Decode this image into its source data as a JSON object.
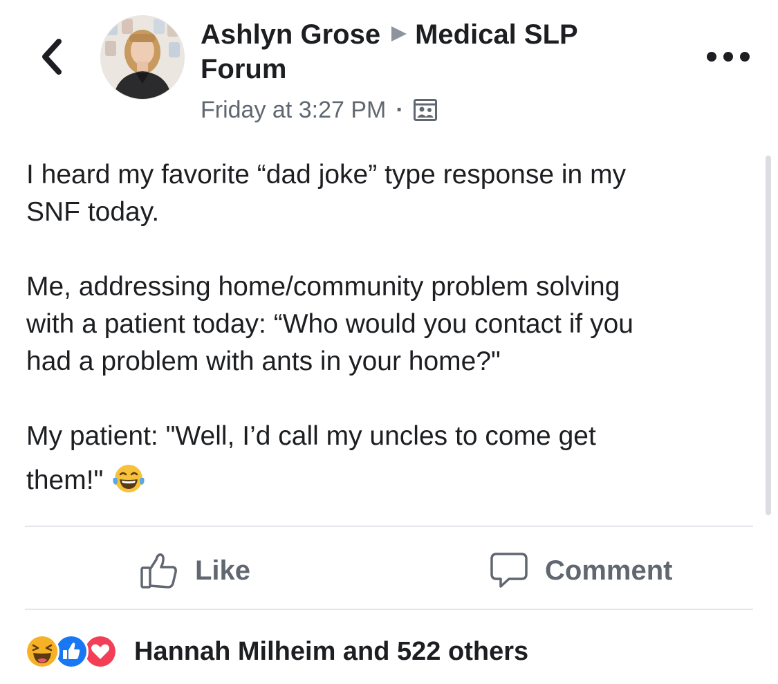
{
  "header": {
    "author": "Ashlyn Grose",
    "group": "Medical SLP",
    "group_line2": "Forum",
    "timestamp": "Friday at 3:27 PM",
    "separator": "·",
    "audience_icon": "group-members-icon",
    "back_icon": "chevron-left-icon",
    "more_icon": "more-horizontal-icon"
  },
  "post": {
    "para1_line1": "I heard my favorite “dad joke” type response in my",
    "para1_line2": "SNF today.",
    "para2_line1": "Me, addressing home/community problem solving",
    "para2_line2": "with a patient today: “Who would you contact if you",
    "para2_line3": "had a problem with ants in your home?\"",
    "para3_line1": "My patient: \"Well, I’d call my uncles to come get",
    "para3_line2": "them!\"",
    "emoji": "laughing-tears-emoji"
  },
  "actions": {
    "like_label": "Like",
    "comment_label": "Comment"
  },
  "reactions": {
    "icons": [
      "haha-reaction-icon",
      "like-reaction-icon",
      "love-reaction-icon"
    ],
    "summary": "Hannah Milheim and 522 others"
  },
  "colors": {
    "text": "#1c1e21",
    "secondary": "#616770",
    "like_blue": "#1877f2",
    "love_red": "#f33e58",
    "haha_yellow": "#f7b125"
  }
}
